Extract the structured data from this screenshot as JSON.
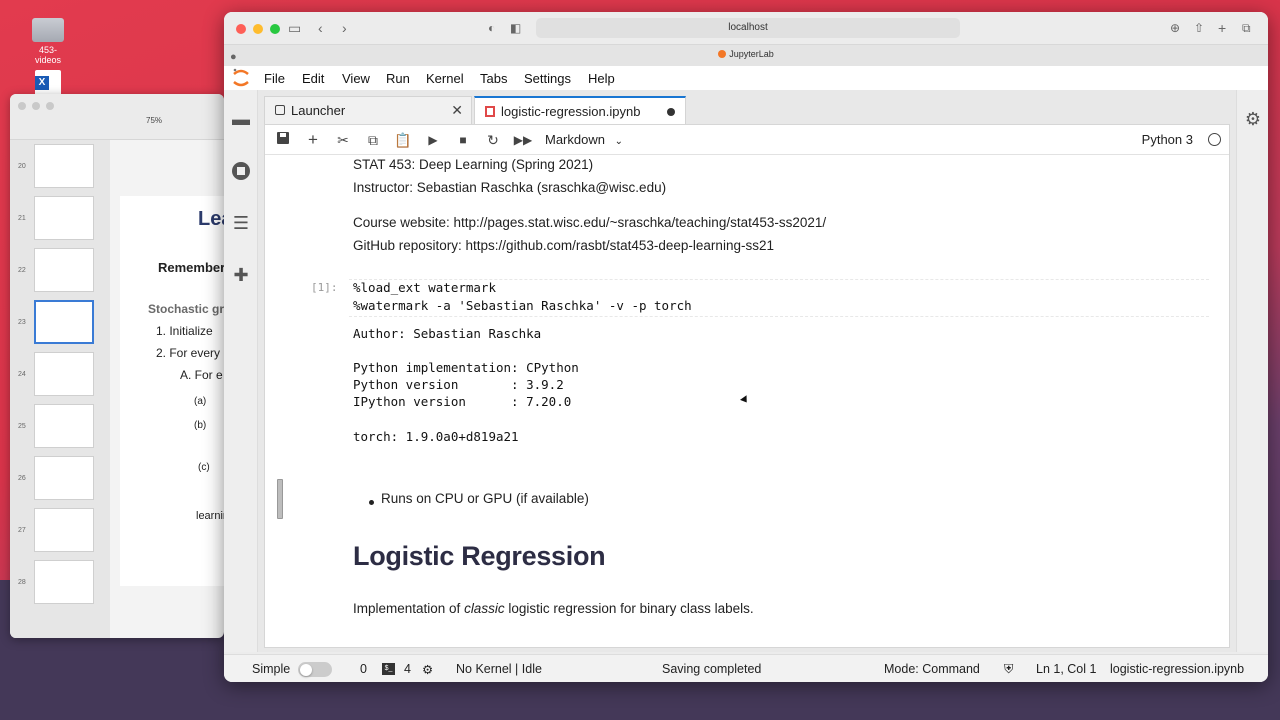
{
  "desktop": {
    "folder_label": "453-videos"
  },
  "slides_app": {
    "zoom": "75%",
    "slide_numbers": [
      "20",
      "21",
      "22",
      "23",
      "24",
      "25",
      "26",
      "27",
      "28"
    ],
    "slide_title": "Lea",
    "lines": [
      "Remember",
      "Stochastic gra",
      "1.   Initialize",
      "2.   For every",
      "A.   For e",
      "(a)",
      "(b)",
      "(c)",
      "learning"
    ]
  },
  "browser": {
    "url": "localhost",
    "tab_title": "JupyterLab"
  },
  "menubar": [
    "File",
    "Edit",
    "View",
    "Run",
    "Kernel",
    "Tabs",
    "Settings",
    "Help"
  ],
  "tabs": {
    "launcher": "Launcher",
    "notebook": "logistic-regression.ipynb"
  },
  "toolbar": {
    "cell_type": "Markdown",
    "kernel": "Python 3"
  },
  "notebook": {
    "md1": [
      "STAT 453: Deep Learning (Spring 2021)",
      "Instructor: Sebastian Raschka (sraschka@wisc.edu)"
    ],
    "md2": [
      "Course website: http://pages.stat.wisc.edu/~sraschka/teaching/stat453-ss2021/",
      "GitHub repository: https://github.com/rasbt/stat453-deep-learning-ss21"
    ],
    "prompt": "[1]:",
    "code": [
      "%load_ext watermark",
      "%watermark -a 'Sebastian Raschka' -v -p torch"
    ],
    "output": [
      "Author: Sebastian Raschka",
      "Python implementation: CPython",
      "Python version       : 3.9.2",
      "IPython version      : 7.20.0",
      "torch: 1.9.0a0+d819a21"
    ],
    "bullet": "Runs on CPU or GPU (if available)",
    "heading": "Logistic Regression",
    "intro_before": "Implementation of ",
    "intro_em": "classic",
    "intro_after": " logistic regression for binary class labels."
  },
  "statusbar": {
    "mode_label": "Simple",
    "count1": "0",
    "count2": "4",
    "kernel_status": "No Kernel | Idle",
    "save_status": "Saving completed",
    "mode": "Mode: Command",
    "position": "Ln 1, Col 1",
    "filename": "logistic-regression.ipynb"
  },
  "colors": {
    "accent": "#1976d2",
    "jupyter_orange": "#f37726",
    "desktop_red": "#e23b4e"
  }
}
